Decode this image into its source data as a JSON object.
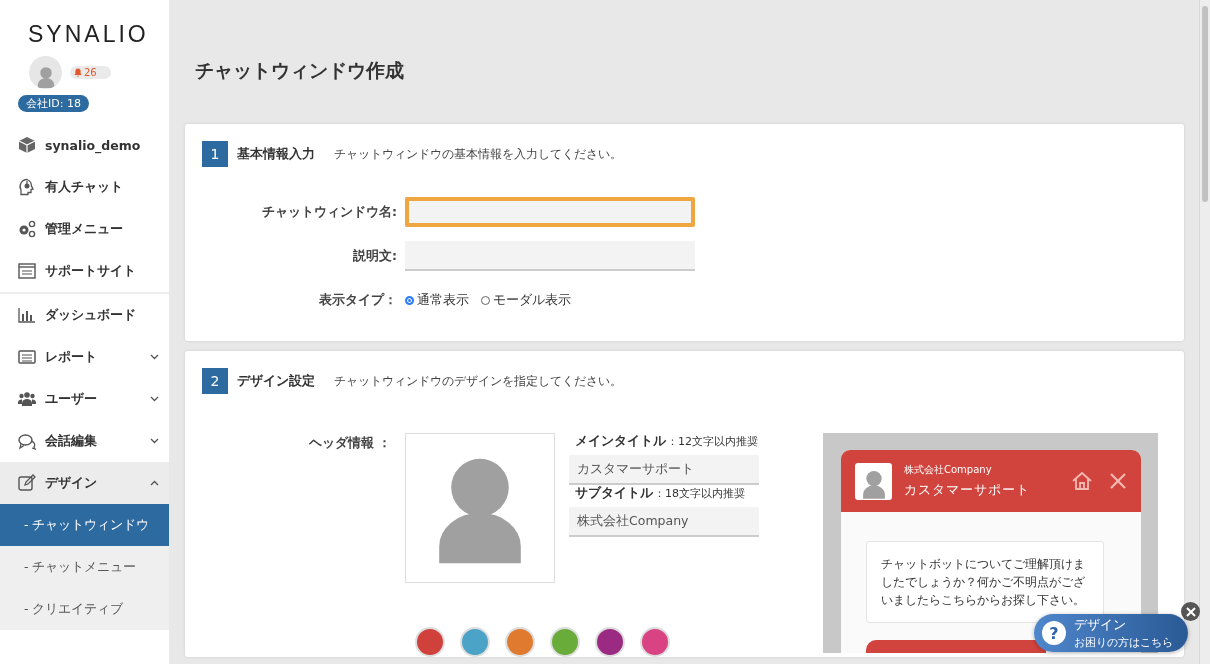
{
  "sidebar": {
    "logo": "SYNALIO",
    "notifications": "26",
    "company_id": "会社ID: 18",
    "groups": [
      {
        "items": [
          {
            "label": "synalio_demo"
          },
          {
            "label": "有人チャット"
          },
          {
            "label": "管理メニュー"
          },
          {
            "label": "サポートサイト"
          }
        ]
      },
      {
        "items": [
          {
            "label": "ダッシュボード"
          },
          {
            "label": "レポート",
            "expanded": false
          },
          {
            "label": "ユーザー",
            "expanded": false
          },
          {
            "label": "会話編集",
            "expanded": false
          },
          {
            "label": "デザイン",
            "expanded": true,
            "children": [
              {
                "label": "- チャットウィンドウ",
                "selected": true
              },
              {
                "label": "- チャットメニュー",
                "selected": false
              },
              {
                "label": "- クリエイティブ",
                "selected": false
              }
            ]
          }
        ]
      }
    ]
  },
  "page_title": "チャットウィンドウ作成",
  "sections": [
    {
      "number": "1",
      "title": "基本情報入力",
      "description": "チャットウィンドウの基本情報を入力してください。",
      "fields": [
        {
          "kind": "text",
          "label": "チャットウィンドウ名:",
          "focused": true
        },
        {
          "kind": "text",
          "label": "説明文:",
          "focused": false
        },
        {
          "kind": "radio",
          "label": "表示タイプ：",
          "options": [
            {
              "label": "通常表示",
              "selected": true
            },
            {
              "label": "モーダル表示",
              "selected": false
            }
          ]
        }
      ]
    },
    {
      "number": "2",
      "title": "デザイン設定",
      "description": "チャットウィンドウのデザインを指定してください。",
      "header_info": {
        "label": "ヘッダ情報 ：",
        "main_title": {
          "label": "メインタイトル",
          "hint": "：12文字以内推奨",
          "value": "カスタマーサポート"
        },
        "subtitle": {
          "label": "サブタイトル",
          "hint": "：18文字以内推奨",
          "value": "株式会社Company"
        }
      },
      "colors": [
        {
          "color": "#d0413c"
        },
        {
          "color": "#4ba3c7"
        },
        {
          "color": "#e07a2f"
        },
        {
          "color": "#6aac3a"
        },
        {
          "color": "#9b2a82"
        },
        {
          "color": "#d94383"
        }
      ],
      "preview": {
        "subtitle": "株式会社Company",
        "title": "カスタマーサポート",
        "message": "チャットボットについてご理解頂けましたでしょうか？何かご不明点がございましたらこちらからお探し下さい。"
      }
    }
  ],
  "help_widget": {
    "icon": "?",
    "title": "デザイン",
    "text": "お困りの方はこちら"
  }
}
